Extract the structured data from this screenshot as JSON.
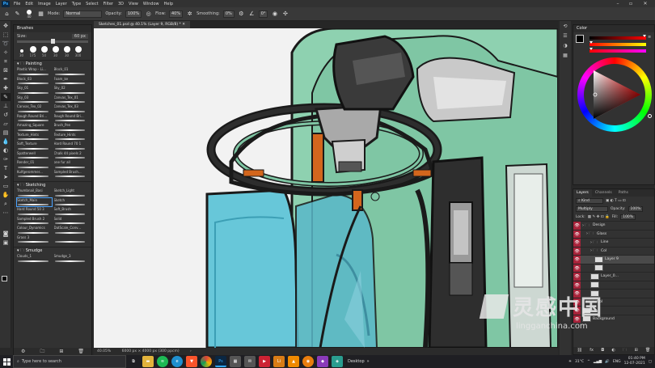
{
  "menu": {
    "items": [
      "File",
      "Edit",
      "Image",
      "Layer",
      "Type",
      "Select",
      "Filter",
      "3D",
      "View",
      "Window",
      "Help"
    ],
    "ps_logo": "Ps"
  },
  "options": {
    "brush_size": "40",
    "mode_label": "Mode:",
    "mode_value": "Normal",
    "opacity_label": "Opacity:",
    "opacity_value": "100%",
    "flow_label": "Flow:",
    "flow_value": "40%",
    "smoothing_label": "Smoothing:",
    "smoothing_value": "0%",
    "angle_value": "0°"
  },
  "document": {
    "tab_title": "Sketches_01.psd @ 40.1% (Layer 9, RGB/8) *",
    "zoom": "40.05%",
    "doc_info": "6000 px × 4000 px (300 ppcm)"
  },
  "brushes": {
    "panel_title": "Brushes",
    "size_label": "Size:",
    "size_value": "60 px",
    "presets": [
      "30",
      "175",
      "50",
      "30",
      "30",
      "300"
    ],
    "groups": [
      {
        "name": "Painting",
        "items": [
          "Plastic Wrap - Li...",
          "Block_01",
          "Block_03",
          "Foam_ke",
          "Sky_01",
          "Sky_02",
          "Sky_03",
          "Canvas_Tex_01",
          "Canvas_Tex_02",
          "Canvas_Tex_03",
          "Rough Round Bri...",
          "Rough Round Bri...",
          "Amazing_Square",
          "Brush_Pen",
          "Texture_Hints",
          "Texture_Hints",
          "Soft_Texture",
          "Hard Round 70 1",
          "Spatterwell",
          "Chalk 44 pixels 2",
          "Render_01",
          "one fur all",
          "Kulfgerommer...",
          "Sampled Brush..."
        ]
      },
      {
        "name": "Sketching",
        "items": [
          "Thumbnail_Basi",
          "Sketch_Light",
          "Sketch_Main",
          "Sketch",
          "Hard Round 50 3",
          "Soft_Brush",
          "Sampled Brush 2",
          "Solid",
          "Colour_Dynamics",
          "DatScale_Conv...",
          "Grass 3",
          ""
        ]
      },
      {
        "name": "Smudge",
        "items": [
          "Clouds_1",
          "Smudge_3"
        ]
      }
    ]
  },
  "color_panel": {
    "title": "Color"
  },
  "layers": {
    "tabs": [
      "Layers",
      "Channels",
      "Paths"
    ],
    "kind_label": "Kind",
    "blend_mode": "Multiply",
    "opacity_label": "Opacity:",
    "opacity_value": "100%",
    "lock_label": "Lock:",
    "fill_label": "Fill:",
    "fill_value": "100%",
    "rows": [
      {
        "name": "Design",
        "type": "folder",
        "indent": 0
      },
      {
        "name": "Glass",
        "type": "folder",
        "indent": 1
      },
      {
        "name": "Line",
        "type": "folder",
        "indent": 2
      },
      {
        "name": "Col",
        "type": "folder",
        "indent": 2
      },
      {
        "name": "Layer 9",
        "type": "layer",
        "indent": 3,
        "selected": true
      },
      {
        "name": "",
        "type": "layer",
        "indent": 3
      },
      {
        "name": "Layer_0...",
        "type": "layer",
        "indent": 2
      },
      {
        "name": "",
        "type": "layer",
        "indent": 2
      },
      {
        "name": "",
        "type": "layer",
        "indent": 2
      },
      {
        "name": "Col",
        "type": "folder",
        "indent": 1
      },
      {
        "name": "",
        "type": "layer",
        "indent": 0
      },
      {
        "name": "Background",
        "type": "layer",
        "indent": 0
      }
    ]
  },
  "taskbar": {
    "search_placeholder": "Type here to search",
    "desktop_label": "Desktop",
    "weather": "31°C",
    "lang": "ENG",
    "time": "01:40 PM",
    "date": "12-07-2021"
  },
  "watermark": {
    "cn_text": "灵感中国",
    "url_text": "lingganchina.com"
  },
  "colors": {
    "panel": "#323232",
    "accent_blue": "#31a8ff",
    "layer_eye_red": "#a8233a",
    "green_body": "#8ed1b0",
    "glass_blue": "#67c7d9"
  }
}
